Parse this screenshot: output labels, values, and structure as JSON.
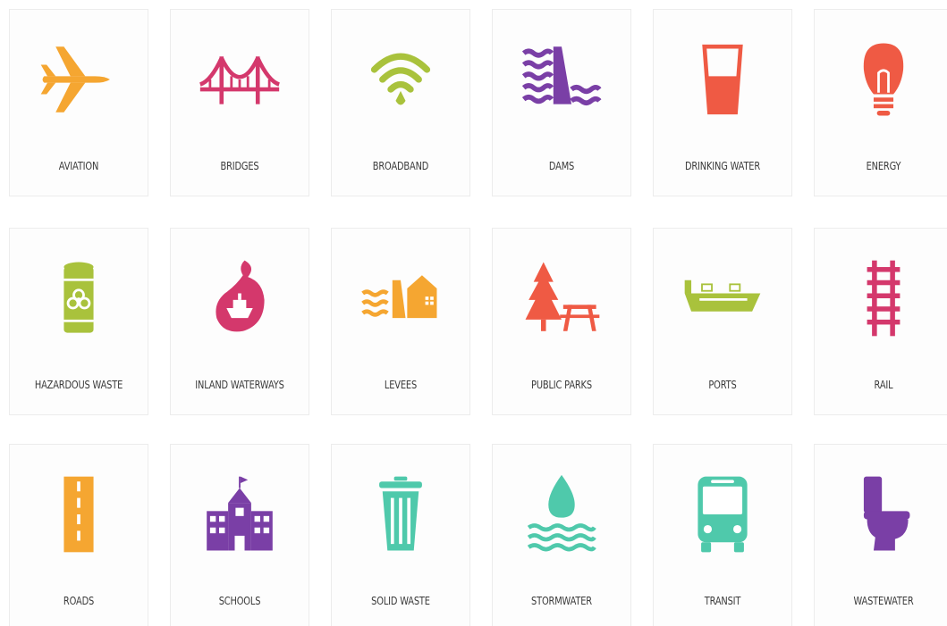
{
  "colors": {
    "orange": "#f5a631",
    "magenta": "#d4386c",
    "lime": "#a9c23c",
    "purple": "#7a3fa6",
    "coral": "#ef5a44",
    "teal": "#4fc9ab"
  },
  "tiles": [
    {
      "label": "AVIATION",
      "icon": "airplane-icon",
      "color": "#f5a631"
    },
    {
      "label": "BRIDGES",
      "icon": "bridge-icon",
      "color": "#d4386c"
    },
    {
      "label": "BROADBAND",
      "icon": "wifi-icon",
      "color": "#a9c23c"
    },
    {
      "label": "DAMS",
      "icon": "dam-icon",
      "color": "#7a3fa6"
    },
    {
      "label": "DRINKING WATER",
      "icon": "water-glass-icon",
      "color": "#ef5a44"
    },
    {
      "label": "ENERGY",
      "icon": "lightbulb-icon",
      "color": "#ef5a44"
    },
    {
      "label": "HAZARDOUS WASTE",
      "icon": "biohazard-barrel-icon",
      "color": "#a9c23c"
    },
    {
      "label": "INLAND WATERWAYS",
      "icon": "ship-icon",
      "color": "#d4386c"
    },
    {
      "label": "LEVEES",
      "icon": "levee-icon",
      "color": "#f5a631"
    },
    {
      "label": "PUBLIC PARKS",
      "icon": "park-icon",
      "color": "#ef5a44"
    },
    {
      "label": "PORTS",
      "icon": "cargo-ship-icon",
      "color": "#a9c23c"
    },
    {
      "label": "RAIL",
      "icon": "rail-track-icon",
      "color": "#d4386c"
    },
    {
      "label": "ROADS",
      "icon": "road-icon",
      "color": "#f5a631"
    },
    {
      "label": "SCHOOLS",
      "icon": "school-icon",
      "color": "#7a3fa6"
    },
    {
      "label": "SOLID WASTE",
      "icon": "trash-can-icon",
      "color": "#4fc9ab"
    },
    {
      "label": "STORMWATER",
      "icon": "water-drop-icon",
      "color": "#4fc9ab"
    },
    {
      "label": "TRANSIT",
      "icon": "bus-icon",
      "color": "#4fc9ab"
    },
    {
      "label": "WASTEWATER",
      "icon": "toilet-icon",
      "color": "#7a3fa6"
    }
  ]
}
